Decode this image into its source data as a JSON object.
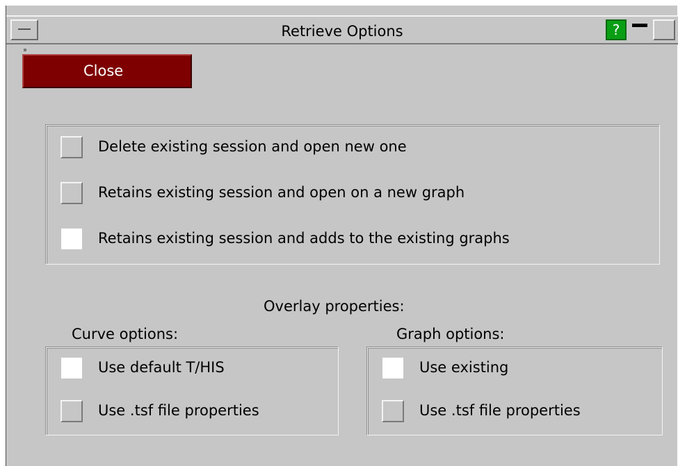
{
  "window": {
    "title": "Retrieve Options",
    "help_glyph": "?"
  },
  "toolbar": {
    "close_label": "Close"
  },
  "session": {
    "options": [
      {
        "label": "Delete existing session and open new one",
        "checked": false
      },
      {
        "label": "Retains existing session and open on a new graph",
        "checked": false
      },
      {
        "label": "Retains existing session and adds to the existing graphs",
        "checked": true
      }
    ]
  },
  "overlay": {
    "label": "Overlay properties:",
    "curve": {
      "legend": "Curve options:",
      "options": [
        {
          "label": "Use default T/HIS",
          "checked": true
        },
        {
          "label": "Use .tsf file properties",
          "checked": false
        }
      ]
    },
    "graph": {
      "legend": "Graph options:",
      "options": [
        {
          "label": "Use existing",
          "checked": true
        },
        {
          "label": "Use .tsf file properties",
          "checked": false
        }
      ]
    }
  },
  "colors": {
    "panel": "#c6c6c6",
    "close_button": "#7e0000",
    "help_button": "#0a9e15",
    "checked_box": "#ffffff"
  },
  "icons": {
    "window_menu": "window-menu-icon",
    "help": "help-icon",
    "minimize": "minimize-icon",
    "maximize": "maximize-icon"
  }
}
